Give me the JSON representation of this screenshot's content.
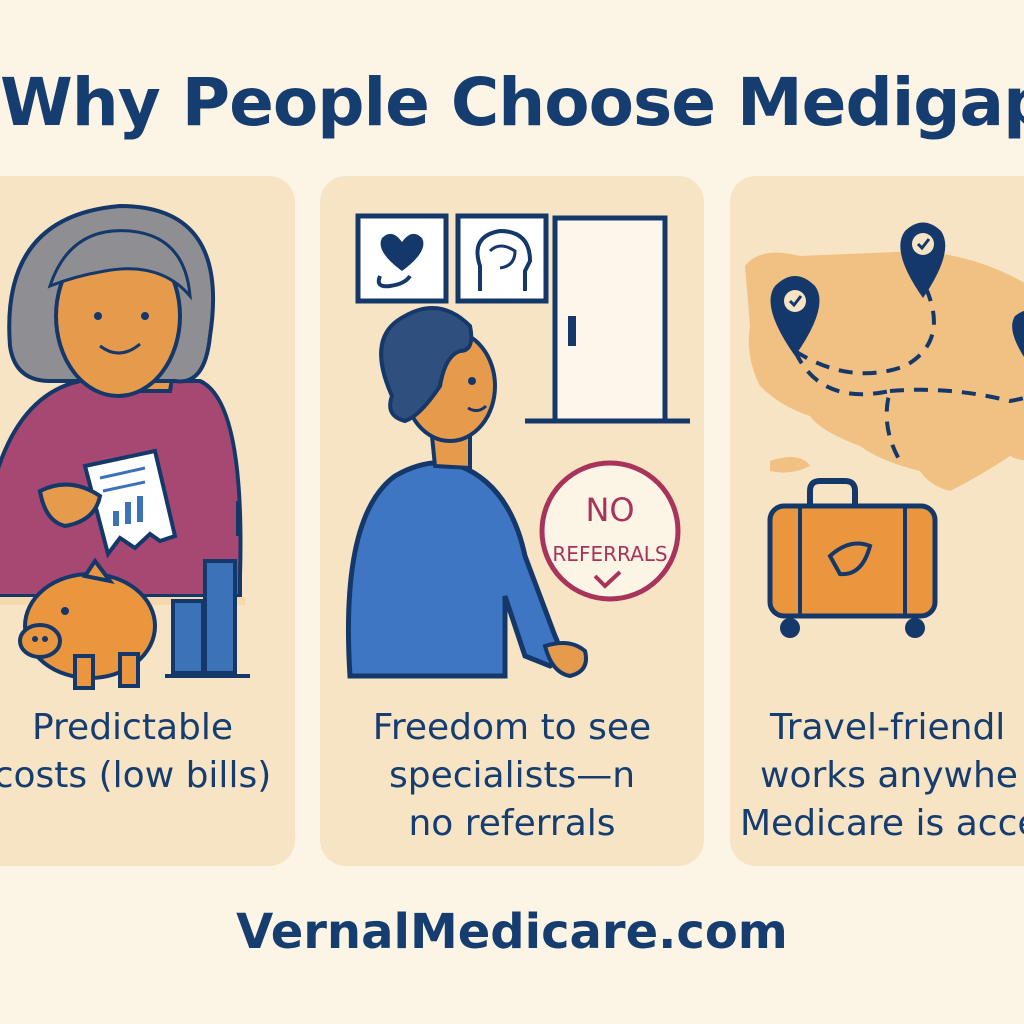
{
  "title": "Why People Choose Medigap",
  "panels": [
    {
      "caption_lines": [
        "Predictable",
        "costs (low bills)"
      ],
      "icons": [
        "senior-woman-illustration",
        "receipt-icon",
        "piggy-bank-icon",
        "bar-chart-icon"
      ]
    },
    {
      "caption_lines": [
        "Freedom to see",
        "specialists—n",
        "no referrals"
      ],
      "badge_line1": "NO",
      "badge_line2": "REFERRALS",
      "icons": [
        "heart-stethoscope-icon",
        "brain-head-icon",
        "door-icon",
        "person-illustration",
        "no-referrals-badge"
      ]
    },
    {
      "caption_lines": [
        "Travel-friendl",
        "works anywhe",
        "Medicare is accep"
      ],
      "icons": [
        "us-map-illustration",
        "location-pin-icon",
        "suitcase-icon"
      ]
    }
  ],
  "footer": "VernalMedicare.com",
  "colors": {
    "background": "#fcf4e4",
    "panel": "#f7e4c4",
    "text": "#163d70",
    "accent_orange": "#e9963e",
    "accent_blue": "#3b72b8",
    "accent_magenta": "#a8345c"
  }
}
